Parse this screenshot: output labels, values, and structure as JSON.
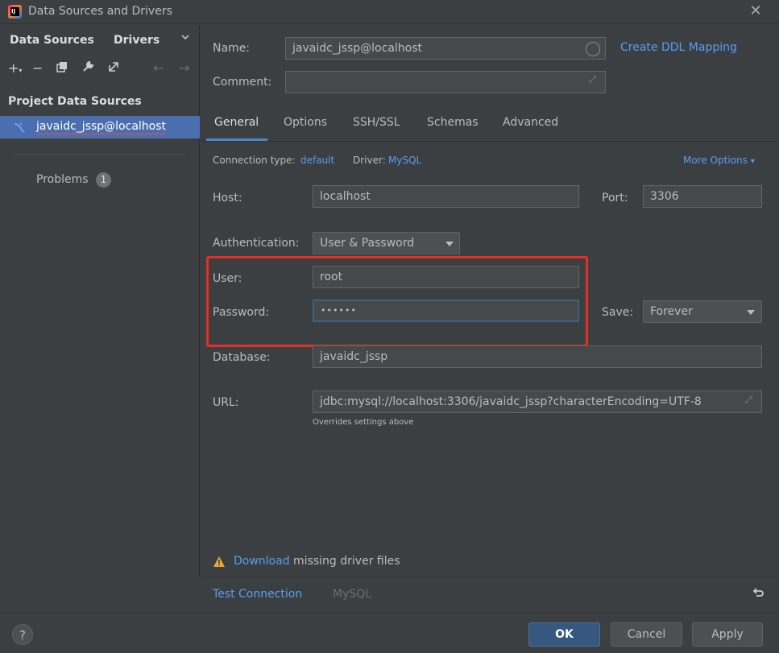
{
  "window": {
    "title": "Data Sources and Drivers",
    "app_icon_text": "IJ"
  },
  "sidebar": {
    "tabs": [
      "Data Sources",
      "Drivers"
    ],
    "section_title": "Project Data Sources",
    "selected_item": "javaidc_jssp@localhost",
    "problems_label": "Problems",
    "problems_count": "1"
  },
  "header": {
    "name_label": "Name:",
    "name_value": "javaidc_jssp@localhost",
    "comment_label": "Comment:",
    "comment_value": "",
    "ddl_link": "Create DDL Mapping"
  },
  "tabs": [
    "General",
    "Options",
    "SSH/SSL",
    "Schemas",
    "Advanced"
  ],
  "general": {
    "connection_type_label": "Connection type:",
    "connection_type_value": "default",
    "driver_label": "Driver:",
    "driver_value": "MySQL",
    "more_options": "More Options",
    "host_label": "Host:",
    "host_value": "localhost",
    "port_label": "Port:",
    "port_value": "3306",
    "auth_label": "Authentication:",
    "auth_value": "User & Password",
    "user_label": "User:",
    "user_value": "root",
    "password_label": "Password:",
    "password_value": "••••••",
    "save_label": "Save:",
    "save_value": "Forever",
    "database_label": "Database:",
    "database_value": "javaidc_jssp",
    "url_label": "URL:",
    "url_value": "jdbc:mysql://localhost:3306/javaidc_jssp?characterEncoding=UTF-8",
    "url_hint": "Overrides settings above"
  },
  "footer": {
    "download_link": "Download",
    "download_rest": "missing driver files",
    "test_connection": "Test Connection",
    "driver_name": "MySQL",
    "ok": "OK",
    "cancel": "Cancel",
    "apply": "Apply",
    "help": "?"
  },
  "colors": {
    "accent": "#4b6eaf",
    "link": "#589df6",
    "highlight_box": "#e52e24",
    "warning": "#f0a732"
  }
}
